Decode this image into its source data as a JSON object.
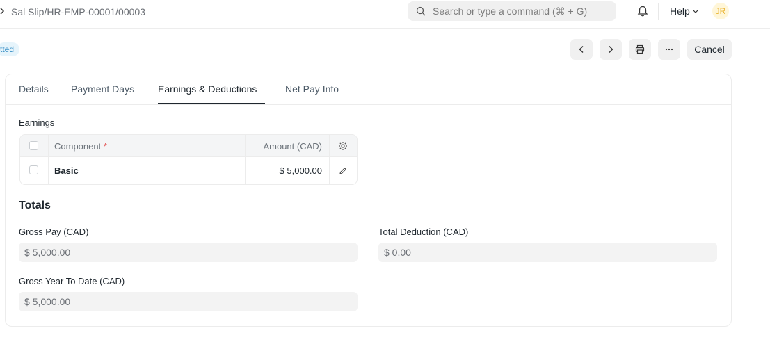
{
  "navbar": {
    "breadcrumb": "Sal Slip/HR-EMP-00001/00003",
    "search_placeholder": "Search or type a command (⌘ + G)",
    "help_label": "Help",
    "avatar_initials": "JR"
  },
  "toolbar": {
    "status": "tted",
    "cancel_label": "Cancel"
  },
  "tabs": [
    "Details",
    "Payment Days",
    "Earnings & Deductions",
    "Net Pay Info"
  ],
  "active_tab": "Earnings & Deductions",
  "earnings": {
    "label": "Earnings",
    "columns": {
      "component": "Component",
      "required_mark": "*",
      "amount": "Amount (CAD)"
    },
    "rows": [
      {
        "component": "Basic",
        "amount": "$ 5,000.00"
      }
    ]
  },
  "totals": {
    "title": "Totals",
    "gross_pay_label": "Gross Pay (CAD)",
    "gross_pay_value": "$ 5,000.00",
    "total_deduction_label": "Total Deduction (CAD)",
    "total_deduction_value": "$ 0.00",
    "gross_ytd_label": "Gross Year To Date (CAD)",
    "gross_ytd_value": "$ 5,000.00"
  },
  "colors": {
    "status_bg": "#e6f4fb",
    "status_text": "#3c91c7",
    "avatar_bg": "#fff6d8",
    "avatar_text": "#e8b12c"
  },
  "icons": [
    "chevron-right-icon",
    "search-icon",
    "bell-icon",
    "chevron-down-icon",
    "chevron-left-icon",
    "printer-icon",
    "more-icon",
    "gear-icon",
    "pencil-icon"
  ]
}
